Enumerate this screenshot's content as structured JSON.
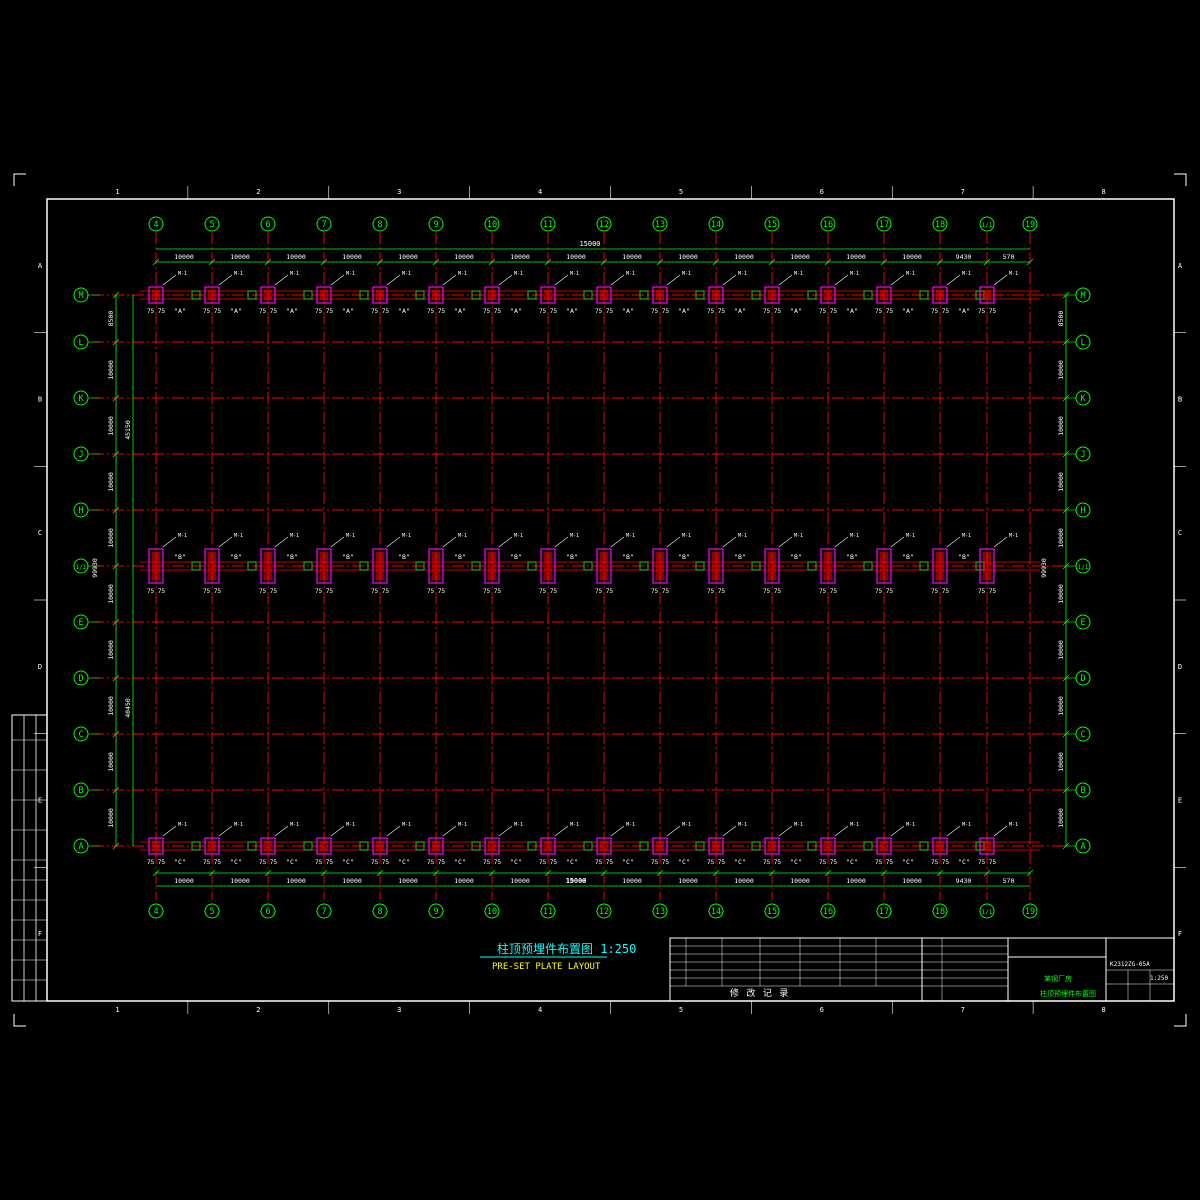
{
  "colors": {
    "background": "#000000",
    "frame": "#ffffff",
    "grid_line": "#ff0000",
    "bubble": "#00ff00",
    "dimension": "#00ff00",
    "plate": "#ff00ff",
    "label": "#ffffff",
    "title": "#00ffff",
    "subtitle": "#ffff00"
  },
  "border_ruler": {
    "columns": [
      "1",
      "2",
      "3",
      "4",
      "5",
      "6",
      "7",
      "8"
    ],
    "rows": [
      "A",
      "B",
      "C",
      "D",
      "E",
      "F"
    ]
  },
  "plan": {
    "column_axes": [
      "4",
      "5",
      "6",
      "7",
      "8",
      "9",
      "10",
      "11",
      "12",
      "13",
      "14",
      "15",
      "16",
      "17",
      "18",
      "1/1",
      "19"
    ],
    "row_axes": [
      "M",
      "L",
      "K",
      "J",
      "H",
      "1/1",
      "E",
      "D",
      "C",
      "B",
      "A"
    ],
    "top_bay_dims": [
      "10000",
      "10000",
      "10000",
      "10000",
      "10000",
      "10000",
      "10000",
      "10000",
      "10000",
      "10000",
      "10000",
      "10000",
      "10000",
      "10000",
      "9430",
      "570"
    ],
    "bottom_bay_dims": [
      "10000",
      "10000",
      "10000",
      "10000",
      "10000",
      "10000",
      "10000",
      "10000",
      "10000",
      "10000",
      "10000",
      "10000",
      "10000",
      "10000",
      "9430",
      "570"
    ],
    "top_overall_dim": "15000",
    "bottom_overall_dim": "15000",
    "left_row_dims": [
      "8500",
      "10000",
      "10000",
      "10000",
      "10000",
      "10000",
      "10000",
      "10000",
      "10000",
      "10000"
    ],
    "right_row_dims": [
      "8500",
      "10000",
      "10000",
      "10000",
      "10000",
      "10000",
      "10000",
      "10000",
      "10000",
      "10000"
    ],
    "left_overall_dims": [
      "45150",
      "40450"
    ],
    "left_mid_dim": "99930",
    "right_mid_dim": "99930",
    "plate_labels": {
      "top": "\"A\"",
      "middle": "\"B\"",
      "bottom": "\"C\""
    },
    "plate_size": "75 75",
    "plate_tag": "M-1"
  },
  "title": {
    "main": "柱顶预埋件布置图 1:250",
    "sub": "PRE-SET PLATE LAYOUT"
  },
  "title_block": {
    "revision_header": "修  改  记  录",
    "project_name": "某钢厂房",
    "drawing_name": "柱顶预埋件布置图",
    "drawing_no": "K2312ZG-05A",
    "scale": "1:250"
  }
}
